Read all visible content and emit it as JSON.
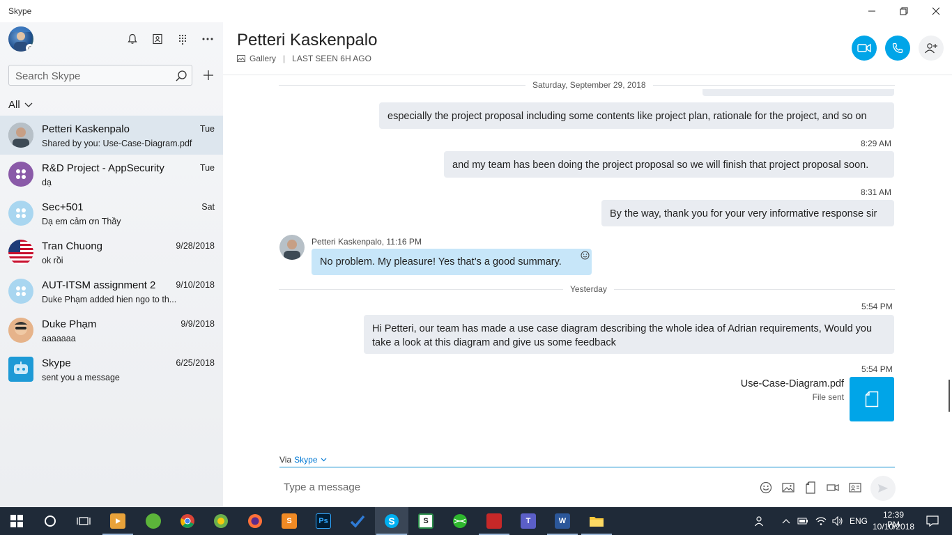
{
  "window": {
    "title": "Skype"
  },
  "sidebar": {
    "search_placeholder": "Search Skype",
    "filter_label": "All",
    "contacts": [
      {
        "name": "Petteri Kaskenpalo",
        "preview": "Shared by you: Use-Case-Diagram.pdf",
        "date": "Tue"
      },
      {
        "name": "R&D Project - AppSecurity",
        "preview": "dạ",
        "date": "Tue"
      },
      {
        "name": "Sec+501",
        "preview": "Dạ em cảm ơn Thầy",
        "date": "Sat"
      },
      {
        "name": "Tran Chuong",
        "preview": "ok rồi",
        "date": "9/28/2018"
      },
      {
        "name": "AUT-ITSM assignment 2",
        "preview": "Duke Phạm added hien ngo to th...",
        "date": "9/10/2018"
      },
      {
        "name": "Duke Phạm",
        "preview": "aaaaaaa",
        "date": "9/9/2018"
      },
      {
        "name": "Skype",
        "preview": "sent you a message",
        "date": "6/25/2018"
      }
    ]
  },
  "header": {
    "contact_name": "Petteri Kaskenpalo",
    "gallery_label": "Gallery",
    "separator": "|",
    "last_seen": "LAST SEEN 6H AGO"
  },
  "conversation": {
    "date_sep_1": "Saturday, September 29, 2018",
    "msg_1": "especially the project proposal including some contents like project plan, rationale for the project, and so on",
    "time_2": "8:29 AM",
    "msg_2": "and my team has been doing the project proposal so we will finish that project proposal soon.",
    "time_3": "8:31 AM",
    "msg_3": "By the way, thank you for your very informative response sir",
    "incoming_sender": "Petteri Kaskenpalo,",
    "incoming_time": "11:16 PM",
    "incoming_msg": "No problem. My pleasure! Yes that’s a good summary.",
    "date_sep_2": "Yesterday",
    "time_4": "5:54 PM",
    "msg_4_line1": "Hi Petteri, our team has made a use case diagram describing the whole idea of Adrian requirements, Would you",
    "msg_4_line2": "take a look at this diagram and give us some feedback",
    "time_5": "5:54 PM",
    "file_name": "Use-Case-Diagram.pdf",
    "file_status": "File sent"
  },
  "compose": {
    "via_label": "Via",
    "via_service": "Skype",
    "placeholder": "Type a message"
  },
  "taskbar": {
    "language": "ENG",
    "time": "12:39 PM",
    "date": "10/10/2018"
  },
  "colors": {
    "accent": "#00a5e8",
    "incoming_bubble": "#c7e6f9",
    "outgoing_bubble": "#e9ecf1",
    "taskbar": "#1f2a38"
  }
}
